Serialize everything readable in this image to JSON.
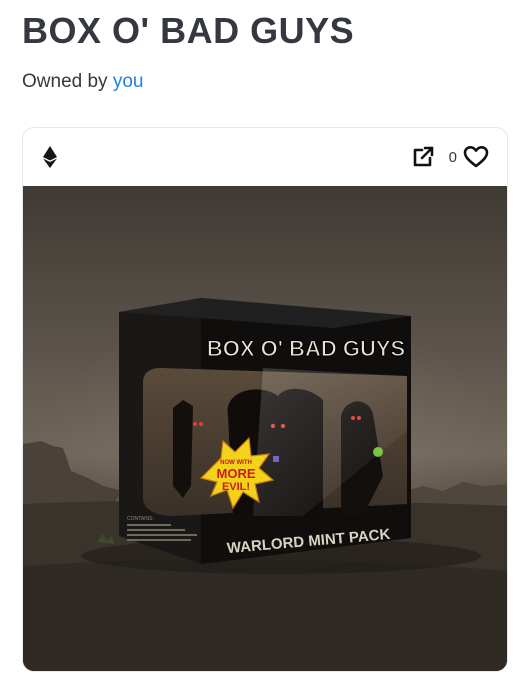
{
  "item": {
    "title": "BOX O' BAD GUYS",
    "owner_prefix": "Owned by ",
    "owner_link": "you",
    "favorites_count": "0"
  },
  "artwork": {
    "box_title": "BOX O' BAD GUYS",
    "pack_label": "WARLORD MINT PACK",
    "burst_top": "NOW WITH",
    "burst_main": "MORE",
    "burst_bottom": "EVIL!",
    "contents_label": "CONTAINS:"
  },
  "icons": {
    "chain": "ethereum-icon",
    "external": "external-link-icon",
    "favorite": "heart-icon"
  },
  "colors": {
    "link": "#2081e2",
    "text": "#353840",
    "border": "#e5e8eb"
  }
}
